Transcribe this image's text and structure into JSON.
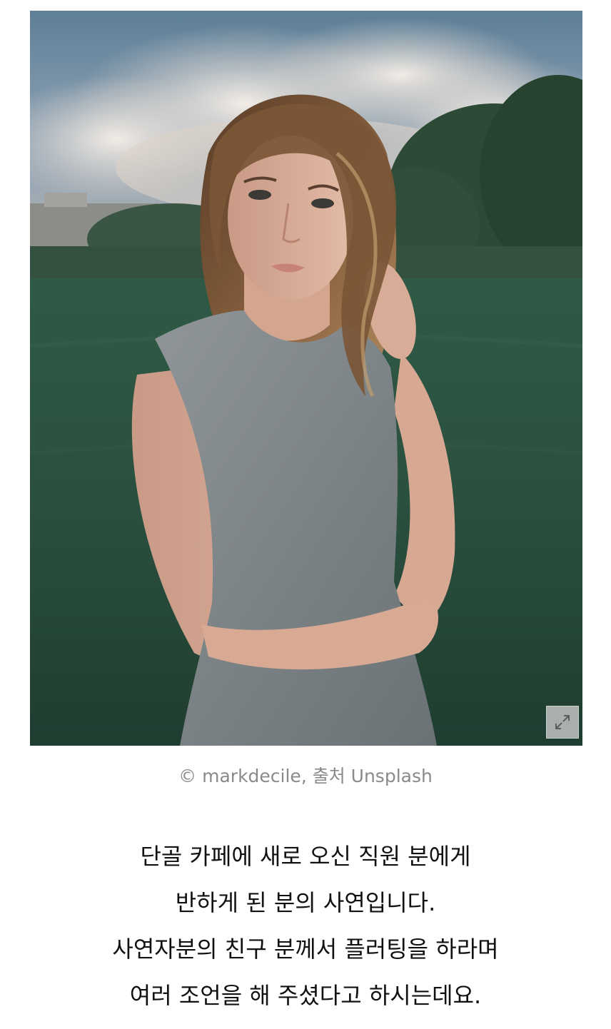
{
  "photo": {
    "alt": "woman in grey sleeveless dress standing in a green field",
    "expand_icon": "expand-arrows-icon"
  },
  "caption": "© markdecile, 출처 Unsplash",
  "paragraph": {
    "lines": [
      "단골 카페에 새로 오신 직원 분에게",
      "반하게 된 분의 사연입니다.",
      "사연자분의 친구 분께서 플러팅을 하라며",
      "여러 조언을 해 주셨다고 하시는데요."
    ]
  }
}
